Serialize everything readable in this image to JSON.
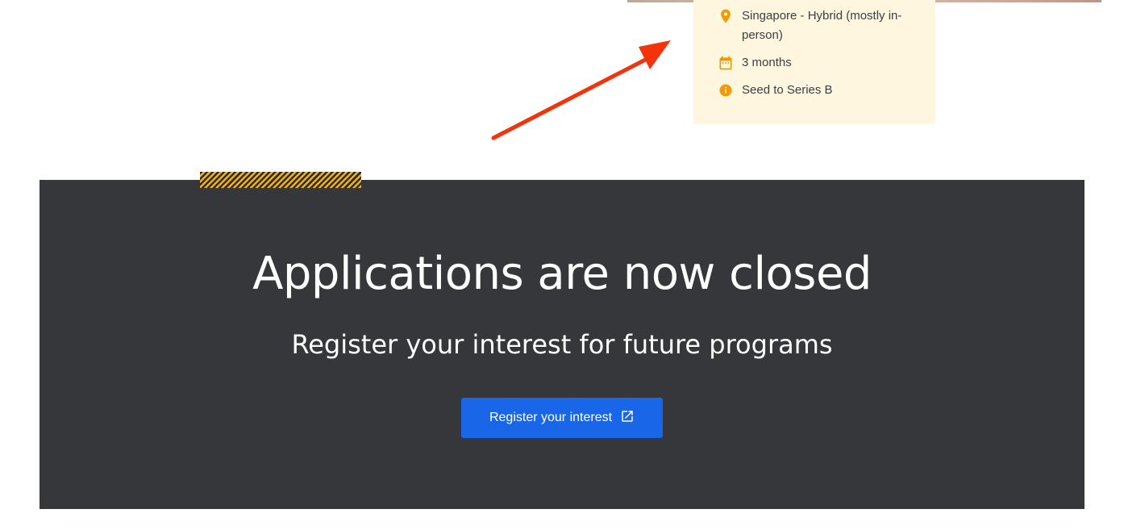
{
  "info_card": {
    "items": [
      {
        "icon": "location-pin-icon",
        "text": "Singapore - Hybrid (mostly in-person)"
      },
      {
        "icon": "calendar-icon",
        "text": "3 months"
      },
      {
        "icon": "info-icon",
        "text": "Seed to Series B"
      }
    ]
  },
  "closed_section": {
    "title": "Applications are now closed",
    "subtitle": "Register your interest for future programs",
    "button_label": "Register your interest",
    "button_icon": "open-in-new-icon"
  },
  "colors": {
    "card_background": "#fef6df",
    "icon_accent": "#f29900",
    "section_background": "#35373a",
    "button_background": "#1a66e8",
    "arrow": "#f4330a",
    "hatch_stripe": "#f5b400"
  }
}
